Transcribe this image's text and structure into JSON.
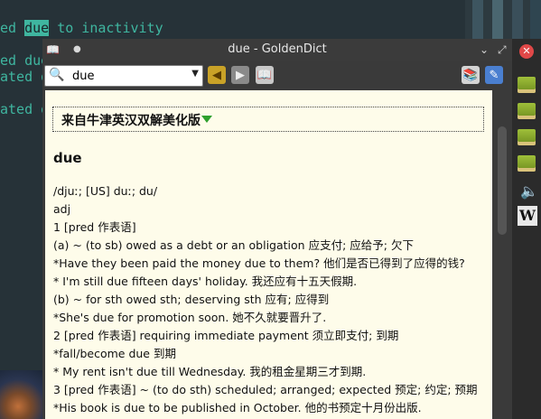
{
  "terminal": {
    "line1_prefix": "ed ",
    "line1_highlight": "due",
    "line1_suffix": " to inactivity",
    "line2": "ed due",
    "line3": "ated d",
    "line4": "ated d"
  },
  "window": {
    "title": "due - GoldenDict"
  },
  "search": {
    "value": "due"
  },
  "article": {
    "dict_name": "来自牛津英汉双解美化版",
    "headword": "due",
    "lines": [
      "/djuː; [US] duː; du/",
      "adj",
      "1 [pred 作表语]",
      "(a) ~ (to sb) owed as a debt or an obligation 应支付; 应给予; 欠下",
      "*Have they been paid the money due to them? 他们是否已得到了应得的钱?",
      "* I'm still due fifteen days' holiday. 我还应有十五天假期.",
      "(b) ~ for sth owed sth; deserving sth 应有; 应得到",
      "*She's due for promotion soon. 她不久就要晋升了.",
      "2 [pred 作表语] requiring immediate payment 须立即支付; 到期",
      "*fall/become due 到期",
      "* My rent isn't due till Wednesday. 我的租金星期三才到期.",
      "3 [pred 作表语] ~ (to do sth) scheduled; arranged; expected 预定; 约定; 预期",
      "*His book is due to be published in October. 他的书预定十月份出版."
    ]
  },
  "dock": {
    "wiki_label": "W"
  },
  "colors": {
    "terminal_text": "#3fb6a0",
    "content_bg": "#fefcea",
    "accent_arrow": "#2ea02e"
  }
}
